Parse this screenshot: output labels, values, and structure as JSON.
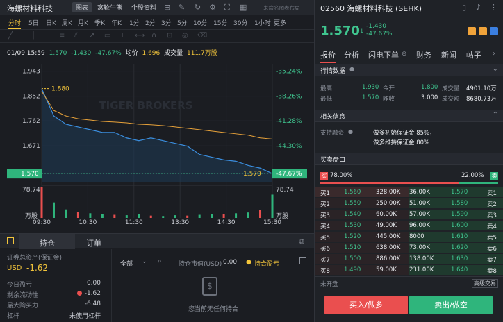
{
  "left": {
    "stock_title": "海螺材料科技",
    "top_tabs": [
      "图表",
      "窝轮牛熊",
      "个股资料"
    ],
    "hint": "未命名图表布局",
    "periods": [
      "分时",
      "5日",
      "日K",
      "周K",
      "月K",
      "季K",
      "年K",
      "1分",
      "2分",
      "3分",
      "5分",
      "10分",
      "15分",
      "30分",
      "1小时",
      "更多"
    ],
    "info": {
      "datetime": "01/09 15:59",
      "price": "1.570",
      "change": "-1.430",
      "pct": "-47.67%",
      "avg_label": "均价",
      "avg_value": "1.696",
      "vol_label": "成交量",
      "vol_value": "111.7万股"
    },
    "watermark": "TIGER BROKERS"
  },
  "chart_data": {
    "type": "line",
    "title": "",
    "x_ticks": [
      "09:30",
      "10:30",
      "11:30",
      "13:30",
      "14:30",
      "15:30"
    ],
    "y_ticks": [
      "1.943",
      "1.852",
      "1.762",
      "1.671",
      "1.570"
    ],
    "y_right_ticks": [
      "-35.24%",
      "-38.26%",
      "-41.28%",
      "-44.30%",
      "-47.67%"
    ],
    "ylim": [
      1.54,
      1.97
    ],
    "current_price_label": "1.570",
    "current_pct_label": "-47.67%",
    "high_marker": "1.880",
    "low_marker": "1.570",
    "volume_label": "78.74",
    "volume_unit": "万股",
    "series": [
      {
        "values": [
          1.88,
          1.78,
          1.75,
          1.74,
          1.73,
          1.72,
          1.72,
          1.7,
          1.69,
          1.7,
          1.69,
          1.68,
          1.67,
          1.64,
          1.63,
          1.62,
          1.615,
          1.6,
          1.59,
          1.57
        ]
      },
      {
        "values": [
          1.87,
          1.8,
          1.78,
          1.77,
          1.765,
          1.76,
          1.758,
          1.755,
          1.75,
          1.748,
          1.745,
          1.74,
          1.735,
          1.73,
          1.725,
          1.72,
          1.715,
          1.71,
          1.7,
          1.696
        ]
      }
    ],
    "volume": [
      78.74,
      40,
      22,
      15,
      12,
      10,
      8,
      7,
      9,
      6,
      5,
      7,
      6,
      8,
      10,
      9,
      12,
      14,
      20,
      60
    ]
  },
  "bottom_left": {
    "tabs": [
      "持仓",
      "订单"
    ],
    "assets_label": "证券总资产(保证金)",
    "currency": "USD",
    "assets_value": "-1.62",
    "rows": [
      {
        "label": "今日盈亏",
        "value": "0.00"
      },
      {
        "label": "剩余流动性",
        "value": "-1.62"
      },
      {
        "label": "最大购买力",
        "value": "-6.48"
      },
      {
        "label": "杠杆",
        "value": "未使用杠杆"
      }
    ],
    "filter_all": "全部",
    "holding_value_label": "持仓市值(USD)",
    "holding_value": "0.00",
    "pnl_label": "持合盈亏",
    "empty_text": "您当前无任何持合"
  },
  "right": {
    "title": "02560 海螺材料科技 (SEHK)",
    "price": "1.570",
    "change": "-1.430",
    "pct": "-47.67%",
    "tabs": [
      "报价",
      "分析",
      "闪电下单",
      "财务",
      "新闻",
      "帖子"
    ],
    "market_data_label": "行情数据",
    "stats": [
      {
        "l1": "最高",
        "v1": "1.930",
        "l2": "今开",
        "v2": "1.800",
        "l3": "成交量",
        "v3": "4901.10万"
      },
      {
        "l1": "最低",
        "v1": "1.570",
        "l2": "昨收",
        "v2": "3.000",
        "l3": "成交额",
        "v3": "8680.73万"
      }
    ],
    "related_label": "相关信息",
    "margin_label": "支持融资",
    "margin_line1": "做多初始保证金 85%，",
    "margin_line2": "做多维持保证金 80%",
    "orderbook_label": "买卖盘口",
    "buy_label": "买",
    "buy_pct": "78.00%",
    "sell_pct": "22.00%",
    "sell_label": "卖",
    "orderbook": [
      {
        "b": "买1",
        "bp": "1.560",
        "bv": "328.00K",
        "sv": "36.00K",
        "sp": "1.570",
        "s": "卖1"
      },
      {
        "b": "买2",
        "bp": "1.550",
        "bv": "250.00K",
        "sv": "51.00K",
        "sp": "1.580",
        "s": "卖2"
      },
      {
        "b": "买3",
        "bp": "1.540",
        "bv": "60.00K",
        "sv": "57.00K",
        "sp": "1.590",
        "s": "卖3"
      },
      {
        "b": "买4",
        "bp": "1.530",
        "bv": "49.00K",
        "sv": "96.00K",
        "sp": "1.600",
        "s": "卖4"
      },
      {
        "b": "买5",
        "bp": "1.520",
        "bv": "445.00K",
        "sv": "8000",
        "sp": "1.610",
        "s": "卖5"
      },
      {
        "b": "买6",
        "bp": "1.510",
        "bv": "638.00K",
        "sv": "73.00K",
        "sp": "1.620",
        "s": "卖6"
      },
      {
        "b": "买7",
        "bp": "1.500",
        "bv": "886.00K",
        "sv": "138.00K",
        "sp": "1.630",
        "s": "卖7"
      },
      {
        "b": "买8",
        "bp": "1.490",
        "bv": "59.00K",
        "sv": "231.00K",
        "sp": "1.640",
        "s": "卖8"
      }
    ],
    "status": "未开盘",
    "advanced_label": "高级交易",
    "buy_button": "买入/做多",
    "sell_button": "卖出/做空"
  }
}
